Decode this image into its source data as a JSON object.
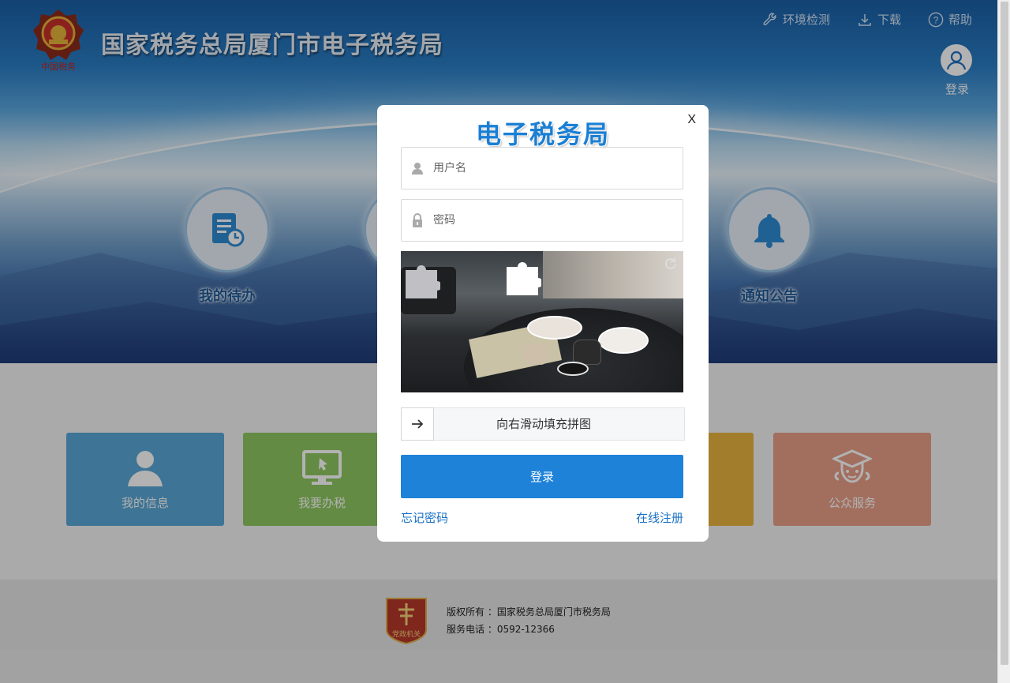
{
  "header": {
    "site_title": "国家税务总局厦门市电子税务局",
    "logo_icon": "tax-emblem-icon",
    "links": [
      {
        "label": "环境检测",
        "icon": "wrench-icon"
      },
      {
        "label": "下载",
        "icon": "download-icon"
      },
      {
        "label": "帮助",
        "icon": "help-icon"
      }
    ],
    "user_login": "登录"
  },
  "banner": {
    "features": [
      {
        "label": "我的待办",
        "icon": "todo-document-icon"
      },
      {
        "label": "",
        "icon": "hidden-feature-icon"
      },
      {
        "label": "通知公告",
        "icon": "bell-icon"
      }
    ]
  },
  "tiles": [
    {
      "label": "我的信息",
      "icon": "user-icon",
      "color": "#5aa6d6"
    },
    {
      "label": "我要办税",
      "icon": "monitor-icon",
      "color": "#8fc860"
    },
    {
      "label": "",
      "icon": "hidden-tile-icon",
      "color": "#e9b440"
    },
    {
      "label": "公众服务",
      "icon": "graduate-service-icon",
      "color": "#e9a088"
    }
  ],
  "footer": {
    "copyright_label": "版权所有 ：",
    "copyright_value": "国家税务总局厦门市税务局",
    "phone_label": "服务电话 ：",
    "phone_value": "0592-12366",
    "badge_icon": "party-government-badge-icon"
  },
  "login_modal": {
    "title": "电子税务局",
    "close_label": "X",
    "username_placeholder": "用户名",
    "password_placeholder": "密码",
    "slider_text": "向右滑动填充拼图",
    "login_button": "登录",
    "forgot_password": "忘记密码",
    "register": "在线注册"
  },
  "colors": {
    "accent": "#1e82d8",
    "link": "#1a70c4",
    "title": "#1a7fd4"
  }
}
